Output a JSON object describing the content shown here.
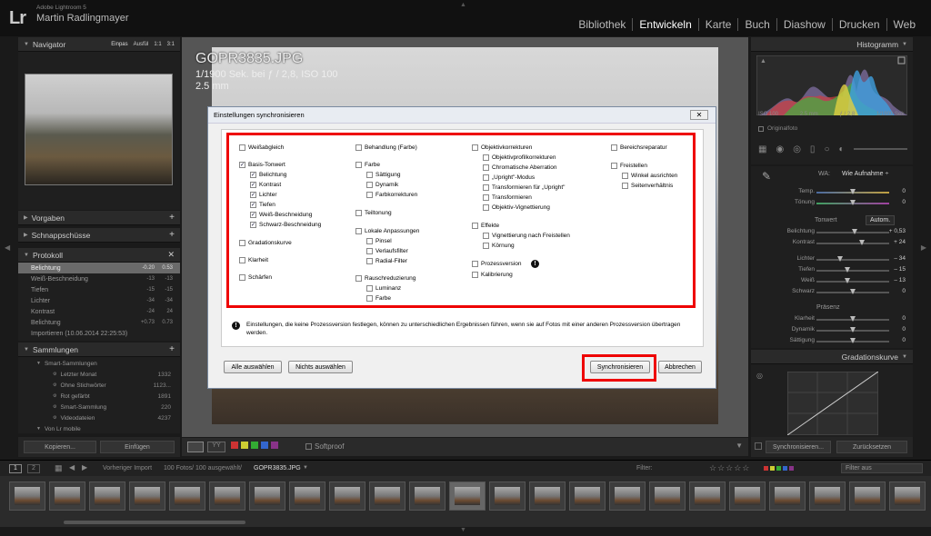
{
  "app": {
    "logo": "Lr",
    "name": "Adobe Lightroom 5",
    "user": "Martin Radlingmayer"
  },
  "modules": [
    "Bibliothek",
    "Entwickeln",
    "Karte",
    "Buch",
    "Diashow",
    "Drucken",
    "Web"
  ],
  "active_module": "Entwickeln",
  "navigator": {
    "title": "Navigator",
    "opts": [
      "Einpas",
      "Ausfül",
      "1:1",
      "3:1"
    ]
  },
  "left_panels": {
    "vorgaben": "Vorgaben",
    "schnappschuesse": "Schnappschüsse",
    "protokoll": "Protokoll",
    "sammlungen": "Sammlungen"
  },
  "history": [
    {
      "label": "Belichtung",
      "v1": "-0.20",
      "v2": "0.53",
      "selected": true
    },
    {
      "label": "Weiß-Beschneidung",
      "v1": "-13",
      "v2": "-13"
    },
    {
      "label": "Tiefen",
      "v1": "-15",
      "v2": "-15"
    },
    {
      "label": "Lichter",
      "v1": "-34",
      "v2": "-34"
    },
    {
      "label": "Kontrast",
      "v1": "-24",
      "v2": "24"
    },
    {
      "label": "Belichtung",
      "v1": "+0.73",
      "v2": "0.73"
    },
    {
      "label": "Importieren (10.06.2014 22:25:53)",
      "v1": "",
      "v2": ""
    }
  ],
  "collections": [
    {
      "label": "Smart-Sammlungen",
      "count": "",
      "indent": 1
    },
    {
      "label": "Letzter Monat",
      "count": "1332",
      "indent": 2
    },
    {
      "label": "Ohne Stichwörter",
      "count": "1123...",
      "indent": 2
    },
    {
      "label": "Rot gefärbt",
      "count": "1891",
      "indent": 2
    },
    {
      "label": "Smart-Sammlung",
      "count": "220",
      "indent": 2
    },
    {
      "label": "Videodateien",
      "count": "4237",
      "indent": 2
    },
    {
      "label": "Von Lr mobile",
      "count": "",
      "indent": 1
    }
  ],
  "left_buttons": {
    "copy": "Kopieren...",
    "paste": "Einfügen"
  },
  "photo_info": {
    "filename": "GOPR3835.JPG",
    "exposure": "1/1900 Sek. bei ƒ / 2,8, ISO 100",
    "focal": "2.5 mm"
  },
  "dialog": {
    "title": "Einstellungen synchronisieren",
    "close": "✕",
    "checkboxes": [
      {
        "label": "Weißabgleich",
        "checked": false
      },
      {
        "label": "Basis-Tonwert",
        "checked": true
      },
      {
        "label": "Belichtung",
        "checked": true
      },
      {
        "label": "Kontrast",
        "checked": true
      },
      {
        "label": "Lichter",
        "checked": true
      },
      {
        "label": "Tiefen",
        "checked": true
      },
      {
        "label": "Weiß-Beschneidung",
        "checked": true
      },
      {
        "label": "Schwarz-Beschneidung",
        "checked": true
      },
      {
        "label": "Gradationskurve",
        "checked": false
      },
      {
        "label": "Klarheit",
        "checked": false
      },
      {
        "label": "Schärfen",
        "checked": false
      },
      {
        "label": "Behandlung (Farbe)",
        "checked": false
      },
      {
        "label": "Farbe",
        "checked": false
      },
      {
        "label": "Sättigung",
        "checked": false
      },
      {
        "label": "Dynamik",
        "checked": false
      },
      {
        "label": "Farbkorrekturen",
        "checked": false
      },
      {
        "label": "Teiltonung",
        "checked": false
      },
      {
        "label": "Lokale Anpassungen",
        "checked": false
      },
      {
        "label": "Pinsel",
        "checked": false
      },
      {
        "label": "Verlaufsfilter",
        "checked": false
      },
      {
        "label": "Radial-Filter",
        "checked": false
      },
      {
        "label": "Rauschreduzierung",
        "checked": false
      },
      {
        "label": "Luminanz",
        "checked": false
      },
      {
        "label": "Farbe",
        "checked": false
      },
      {
        "label": "Objektivkorrekturen",
        "checked": false
      },
      {
        "label": "Objektivprofilkorrekturen",
        "checked": false
      },
      {
        "label": "Chromatische Aberration",
        "checked": false
      },
      {
        "label": "„Upright\"-Modus",
        "checked": false
      },
      {
        "label": "Transformieren für „Upright\"",
        "checked": false
      },
      {
        "label": "Transformieren",
        "checked": false
      },
      {
        "label": "Objektiv-Vignettierung",
        "checked": false
      },
      {
        "label": "Effekte",
        "checked": false
      },
      {
        "label": "Vignettierung nach Freistellen",
        "checked": false
      },
      {
        "label": "Körnung",
        "checked": false
      },
      {
        "label": "Prozessversion",
        "checked": false
      },
      {
        "label": "Kalibrierung",
        "checked": false
      },
      {
        "label": "Bereichsreparatur",
        "checked": false
      },
      {
        "label": "Freistellen",
        "checked": false
      },
      {
        "label": "Winkel ausrichten",
        "checked": false
      },
      {
        "label": "Seitenverhältnis",
        "checked": false
      }
    ],
    "warning": "Einstellungen, die keine Prozessversion festlegen, können zu unterschiedlichen Ergebnissen führen, wenn sie auf Fotos mit einer anderen Prozessversion übertragen werden.",
    "buttons": {
      "select_all": "Alle auswählen",
      "select_none": "Nichts auswählen",
      "sync": "Synchronisieren",
      "cancel": "Abbrechen"
    }
  },
  "histogram": {
    "title": "Histogramm",
    "iso": "ISO 100",
    "focal": "2.5 mm",
    "aperture": "ƒ / 2,8",
    "shutter": "1/1900 Sek.",
    "original": "Originalfoto"
  },
  "basic": {
    "wb_label": "WA:",
    "wb_value": "Wie Aufnahme ÷",
    "temp": {
      "label": "Temp.",
      "value": "0"
    },
    "tint": {
      "label": "Tönung",
      "value": "0"
    },
    "tone_label": "Tonwert",
    "auto": "Autom.",
    "tone": [
      {
        "label": "Belichtung",
        "value": "+ 0,53",
        "pos": 0.53
      },
      {
        "label": "Kontrast",
        "value": "+ 24",
        "pos": 0.62
      },
      {
        "label": "Lichter",
        "value": "– 34",
        "pos": 0.33
      },
      {
        "label": "Tiefen",
        "value": "– 15",
        "pos": 0.42
      },
      {
        "label": "Weiß",
        "value": "– 13",
        "pos": 0.43
      },
      {
        "label": "Schwarz",
        "value": "0",
        "pos": 0.5
      }
    ],
    "presence_label": "Präsenz",
    "presence": [
      {
        "label": "Klarheit",
        "value": "0",
        "pos": 0.5
      },
      {
        "label": "Dynamik",
        "value": "0",
        "pos": 0.5
      },
      {
        "label": "Sättigung",
        "value": "0",
        "pos": 0.5
      }
    ],
    "curve_title": "Gradationskurve"
  },
  "right_buttons": {
    "sync": "Synchronisieren...",
    "reset": "Zurücksetzen"
  },
  "toolbar": {
    "softproof": "Softproof"
  },
  "filmstrip": {
    "source": "Vorheriger Import",
    "count": "100 Fotos/ 100 ausgewählt/",
    "file": "GOPR3835.JPG",
    "filter_label": "Filter:",
    "filter_value": "Filter aus",
    "page1": "1",
    "page2": "2"
  }
}
